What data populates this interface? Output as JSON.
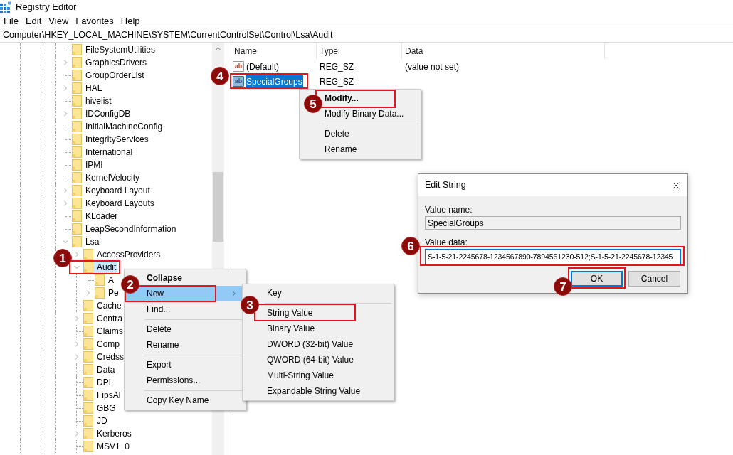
{
  "window": {
    "title": "Registry Editor"
  },
  "menu_bar": [
    "File",
    "Edit",
    "View",
    "Favorites",
    "Help"
  ],
  "address_bar": "Computer\\HKEY_LOCAL_MACHINE\\SYSTEM\\CurrentControlSet\\Control\\Lsa\\Audit",
  "tree": [
    {
      "label": "FileSystemUtilities",
      "expandable": false,
      "expanded": false,
      "selected": false
    },
    {
      "label": "GraphicsDrivers",
      "expandable": true,
      "expanded": false,
      "selected": false
    },
    {
      "label": "GroupOrderList",
      "expandable": false,
      "expanded": false,
      "selected": false
    },
    {
      "label": "HAL",
      "expandable": true,
      "expanded": false,
      "selected": false
    },
    {
      "label": "hivelist",
      "expandable": false,
      "expanded": false,
      "selected": false
    },
    {
      "label": "IDConfigDB",
      "expandable": true,
      "expanded": false,
      "selected": false
    },
    {
      "label": "InitialMachineConfig",
      "expandable": false,
      "expanded": false,
      "selected": false
    },
    {
      "label": "IntegrityServices",
      "expandable": false,
      "expanded": false,
      "selected": false
    },
    {
      "label": "International",
      "expandable": false,
      "expanded": false,
      "selected": false
    },
    {
      "label": "IPMI",
      "expandable": false,
      "expanded": false,
      "selected": false
    },
    {
      "label": "KernelVelocity",
      "expandable": false,
      "expanded": false,
      "selected": false
    },
    {
      "label": "Keyboard Layout",
      "expandable": true,
      "expanded": false,
      "selected": false
    },
    {
      "label": "Keyboard Layouts",
      "expandable": true,
      "expanded": false,
      "selected": false
    },
    {
      "label": "KLoader",
      "expandable": false,
      "expanded": false,
      "selected": false
    },
    {
      "label": "LeapSecondInformation",
      "expandable": false,
      "expanded": false,
      "selected": false
    },
    {
      "label": "Lsa",
      "expandable": true,
      "expanded": true,
      "selected": false,
      "children": [
        {
          "label": "AccessProviders",
          "expandable": true,
          "expanded": false,
          "selected": false
        },
        {
          "label": "Audit",
          "expandable": true,
          "expanded": true,
          "selected": true,
          "callout": "1",
          "children": [
            {
              "label": "A",
              "expandable": false,
              "expanded": false,
              "selected": false
            },
            {
              "label": "Pe",
              "expandable": true,
              "expanded": false,
              "selected": false
            }
          ]
        },
        {
          "label": "Cache",
          "expandable": false,
          "expanded": false,
          "selected": false
        },
        {
          "label": "Centra",
          "expandable": true,
          "expanded": false,
          "selected": false
        },
        {
          "label": "Claims",
          "expandable": false,
          "expanded": false,
          "selected": false
        },
        {
          "label": "Comp",
          "expandable": true,
          "expanded": false,
          "selected": false
        },
        {
          "label": "Credss",
          "expandable": true,
          "expanded": false,
          "selected": false
        },
        {
          "label": "Data",
          "expandable": false,
          "expanded": false,
          "selected": false
        },
        {
          "label": "DPL",
          "expandable": false,
          "expanded": false,
          "selected": false
        },
        {
          "label": "FipsAl",
          "expandable": false,
          "expanded": false,
          "selected": false
        },
        {
          "label": "GBG",
          "expandable": false,
          "expanded": false,
          "selected": false
        },
        {
          "label": "JD",
          "expandable": false,
          "expanded": false,
          "selected": false
        },
        {
          "label": "Kerberos",
          "expandable": true,
          "expanded": false,
          "selected": false
        },
        {
          "label": "MSV1_0",
          "expandable": false,
          "expanded": false,
          "selected": false
        }
      ]
    }
  ],
  "values_list": {
    "columns": [
      "Name",
      "Type",
      "Data"
    ],
    "rows": [
      {
        "icon": "ab",
        "name": "(Default)",
        "type": "REG_SZ",
        "data": "(value not set)",
        "selected": false
      },
      {
        "icon": "ab",
        "name": "SpecialGroups",
        "type": "REG_SZ",
        "selected": true,
        "callout": "4"
      }
    ]
  },
  "values_context_menu": [
    {
      "kind": "item",
      "label": "Modify...",
      "default": true,
      "highlighted": false,
      "callout": "5"
    },
    {
      "kind": "item",
      "label": "Modify Binary Data...",
      "default": false,
      "highlighted": false
    },
    {
      "kind": "separator"
    },
    {
      "kind": "item",
      "label": "Delete",
      "default": false,
      "highlighted": false
    },
    {
      "kind": "item",
      "label": "Rename",
      "default": false,
      "highlighted": false
    }
  ],
  "tree_context_menu": [
    {
      "kind": "item",
      "label": "Collapse",
      "default": true,
      "highlighted": false,
      "submenu": false
    },
    {
      "kind": "item",
      "label": "New",
      "default": false,
      "highlighted": true,
      "submenu": true,
      "callout": "2"
    },
    {
      "kind": "item",
      "label": "Find...",
      "default": false,
      "highlighted": false,
      "submenu": false
    },
    {
      "kind": "separator"
    },
    {
      "kind": "item",
      "label": "Delete",
      "default": false,
      "highlighted": false,
      "submenu": false
    },
    {
      "kind": "item",
      "label": "Rename",
      "default": false,
      "highlighted": false,
      "submenu": false
    },
    {
      "kind": "separator"
    },
    {
      "kind": "item",
      "label": "Export",
      "default": false,
      "highlighted": false,
      "submenu": false
    },
    {
      "kind": "item",
      "label": "Permissions...",
      "default": false,
      "highlighted": false,
      "submenu": false
    },
    {
      "kind": "separator"
    },
    {
      "kind": "item",
      "label": "Copy Key Name",
      "default": false,
      "highlighted": false,
      "submenu": false
    }
  ],
  "new_submenu": [
    {
      "kind": "item",
      "label": "Key",
      "default": false,
      "highlighted": false
    },
    {
      "kind": "separator"
    },
    {
      "kind": "item",
      "label": "String Value",
      "default": false,
      "highlighted": false,
      "callout": "3"
    },
    {
      "kind": "item",
      "label": "Binary Value",
      "default": false,
      "highlighted": false
    },
    {
      "kind": "item",
      "label": "DWORD (32-bit) Value",
      "default": false,
      "highlighted": false
    },
    {
      "kind": "item",
      "label": "QWORD (64-bit) Value",
      "default": false,
      "highlighted": false
    },
    {
      "kind": "item",
      "label": "Multi-String Value",
      "default": false,
      "highlighted": false
    },
    {
      "kind": "item",
      "label": "Expandable String Value",
      "default": false,
      "highlighted": false
    }
  ],
  "edit_string_dialog": {
    "title": "Edit String",
    "fields": [
      {
        "label": "Value name:",
        "value": "SpecialGroups",
        "readonly": true,
        "focused": false
      },
      {
        "label": "Value data:",
        "value": "S-1-5-21-2245678-1234567890-7894561230-512;S-1-5-21-2245678-12345",
        "readonly": false,
        "focused": true,
        "callout": "6"
      }
    ],
    "buttons": [
      {
        "label": "OK",
        "default": true,
        "callout": "7"
      },
      {
        "label": "Cancel",
        "default": false
      }
    ]
  }
}
